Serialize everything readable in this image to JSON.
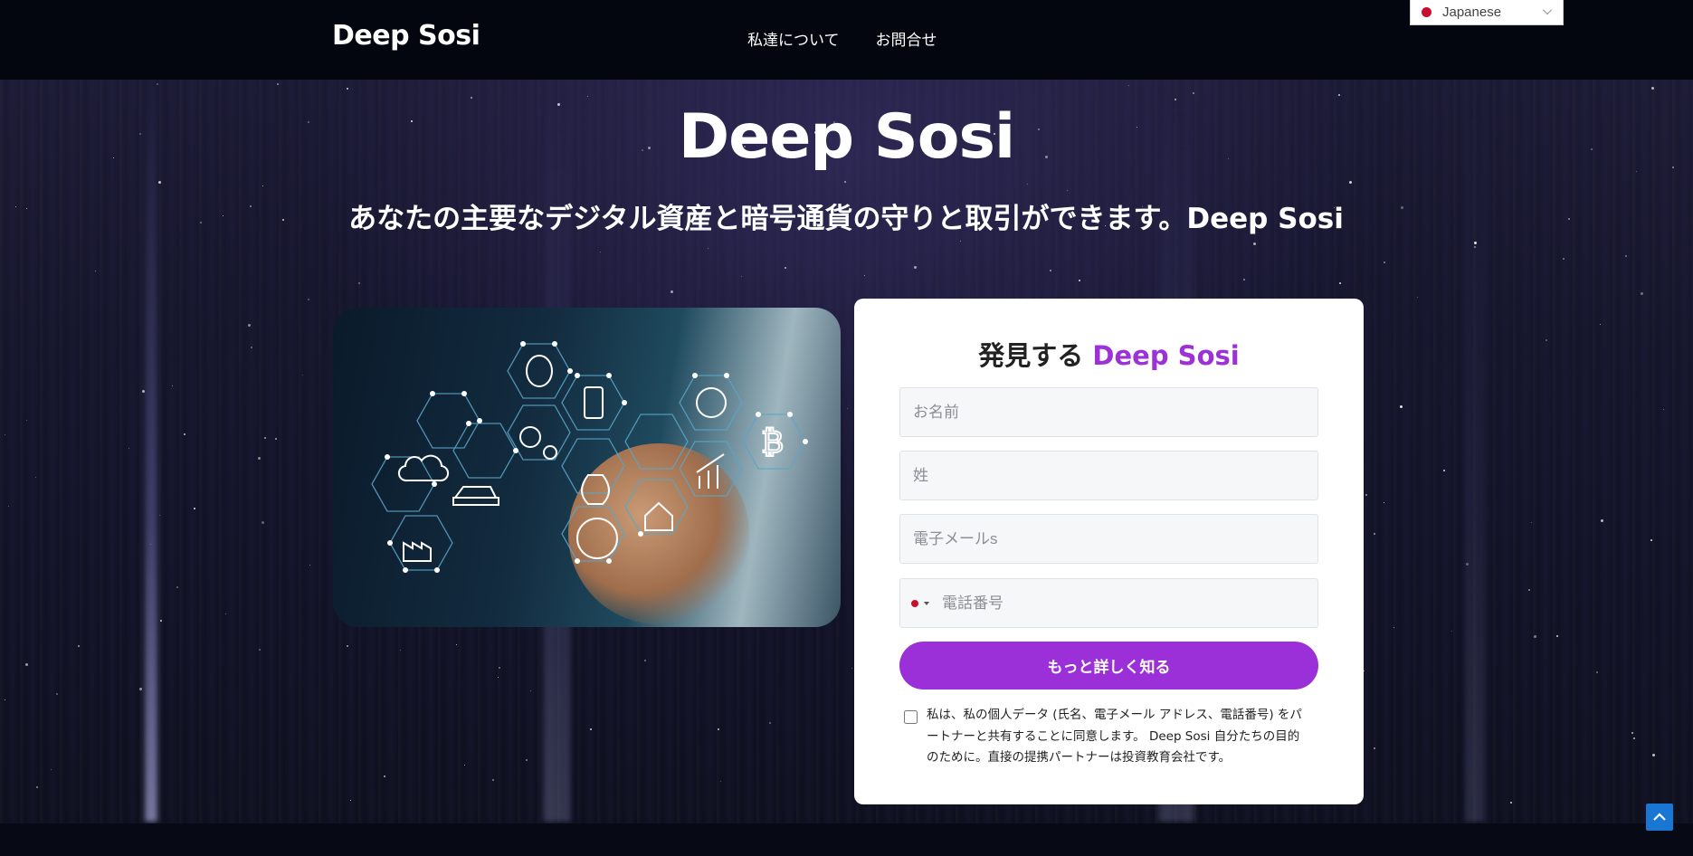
{
  "header": {
    "logo": "Deep Sosi",
    "nav": [
      "私達について",
      "お問合せ"
    ],
    "language": "Japanese"
  },
  "hero": {
    "title": "Deep Sosi",
    "subtitle": "あなたの主要なデジタル資産と暗号通貨の守りと取引ができます。Deep Sosi"
  },
  "form": {
    "title_prefix": "発見する",
    "title_brand": "Deep Sosi",
    "first_name_placeholder": "お名前",
    "last_name_placeholder": "姓",
    "email_placeholder": "電子メールs",
    "phone_placeholder": "電話番号",
    "submit_label": "もっと詳しく知る",
    "consent_text": "私は、私の個人データ (氏名、電子メール アドレス、電話番号) をパートナーと共有することに同意します。 Deep Sosi 自分たちの目的のために。直接の提携パートナーは投資教育会社です。"
  },
  "colors": {
    "accent": "#9b2fd8",
    "header_bg": "#04060f",
    "scroll_top": "#1976d2"
  },
  "icons": [
    "brain-icon",
    "phone-icon",
    "bitcoin-icon",
    "cloud-lock-icon",
    "gears-icon",
    "ev-car-icon",
    "money-bag-icon",
    "smart-home-icon",
    "chart-up-icon",
    "factory-icon",
    "globe-icon",
    "ai-brain-icon",
    "chevron-up-icon"
  ]
}
